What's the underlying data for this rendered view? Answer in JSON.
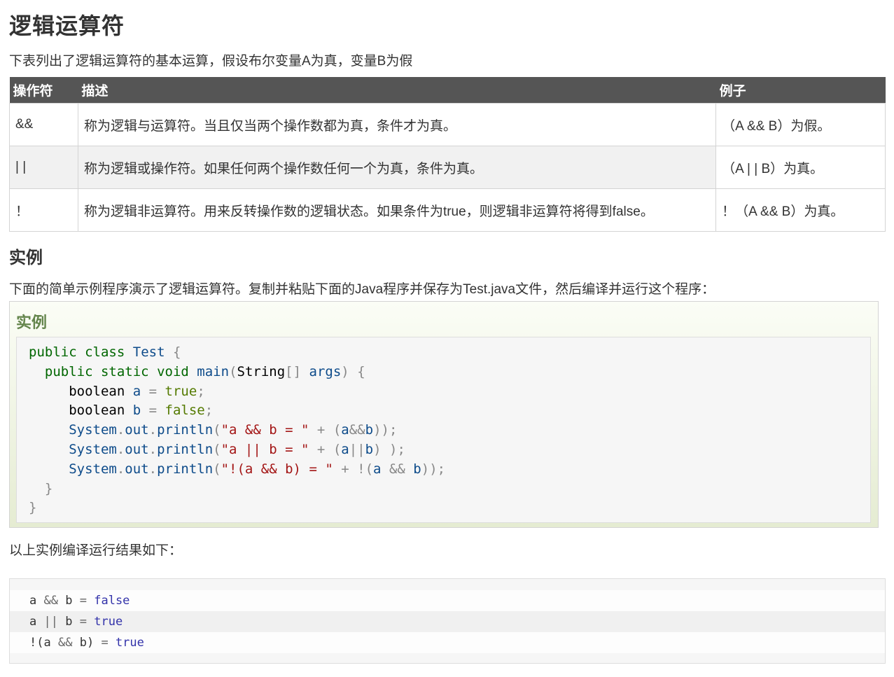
{
  "title": "逻辑运算符",
  "intro": "下表列出了逻辑运算符的基本运算，假设布尔变量A为真，变量B为假",
  "table": {
    "headers": [
      "操作符",
      "描述",
      "例子"
    ],
    "rows": [
      {
        "op": "&&",
        "desc": "称为逻辑与运算符。当且仅当两个操作数都为真，条件才为真。",
        "example": "（A && B）为假。"
      },
      {
        "op": "| |",
        "desc": "称为逻辑或操作符。如果任何两个操作数任何一个为真，条件为真。",
        "example": "（A | | B）为真。"
      },
      {
        "op": "！",
        "desc": "称为逻辑非运算符。用来反转操作数的逻辑状态。如果条件为true，则逻辑非运算符将得到false。",
        "example": "！（A && B）为真。"
      }
    ]
  },
  "section_title": "实例",
  "section_desc": "下面的简单示例程序演示了逻辑运算符。复制并粘贴下面的Java程序并保存为Test.java文件，然后编译并运行这个程序：",
  "example_title": "实例",
  "code_lines": [
    "public class Test {",
    "  public static void main(String[] args) {",
    "     boolean a = true;",
    "     boolean b = false;",
    "     System.out.println(\"a && b = \" + (a&&b));",
    "     System.out.println(\"a || b = \" + (a||b) );",
    "     System.out.println(\"!(a && b) = \" + !(a && b));",
    "  }",
    "}"
  ],
  "result_intro": "以上实例编译运行结果如下：",
  "output_lines": [
    "a && b = false",
    "a || b = true",
    "!(a && b) = true"
  ]
}
